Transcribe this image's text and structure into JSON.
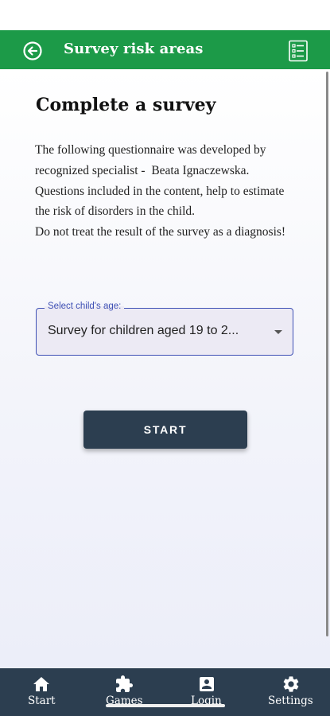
{
  "app_bar": {
    "title": "Survey risk areas"
  },
  "page": {
    "title": "Complete a survey",
    "description": "The following questionnaire was developed by recognized specialist -  Beata Ignaczewska. Questions included in the content, help to estimate the risk of disorders in the child.\nDo not treat the result of the survey as a diagnosis!"
  },
  "age_select": {
    "label": "Select child's age:",
    "value": "Survey for children aged 19 to 2..."
  },
  "start_button": {
    "label": "START"
  },
  "bottom_nav": {
    "items": [
      {
        "label": "Start",
        "icon": "home-icon"
      },
      {
        "label": "Games",
        "icon": "puzzle-icon"
      },
      {
        "label": "Login",
        "icon": "account-box-icon"
      },
      {
        "label": "Settings",
        "icon": "gear-icon"
      }
    ]
  },
  "colors": {
    "app_bar": "#1c9a48",
    "bottom_nav": "#2c3e50",
    "button": "#2c3e50",
    "select_accent": "#3f51b5"
  }
}
